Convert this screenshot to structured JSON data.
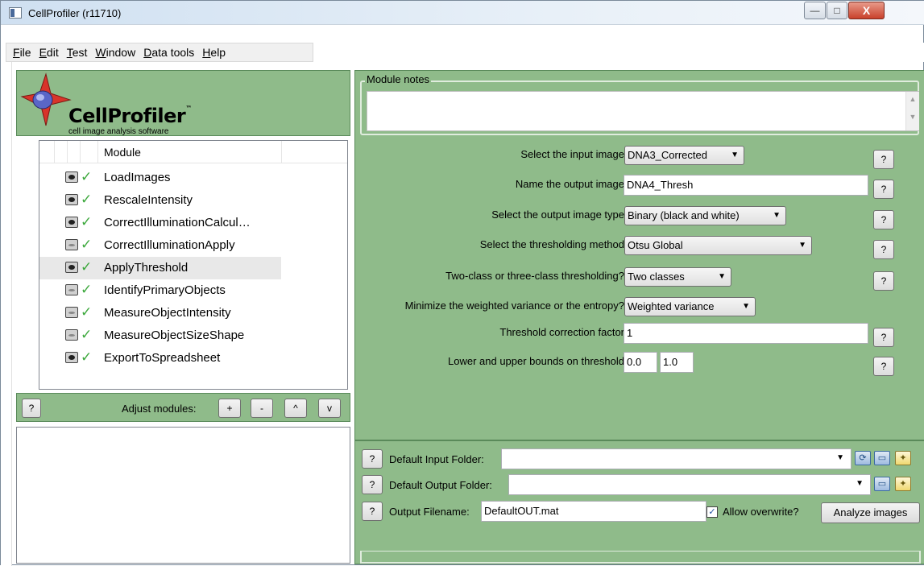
{
  "window": {
    "title": "CellProfiler (r11710)",
    "controls": {
      "minimize": "—",
      "maximize": "□",
      "close": "X"
    }
  },
  "menu": [
    "File",
    "Edit",
    "Test",
    "Window",
    "Data tools",
    "Help"
  ],
  "logo": {
    "name": "CellProfiler",
    "tm": "™",
    "subtitle": "cell image analysis software"
  },
  "module_list": {
    "header": "Module",
    "items": [
      {
        "name": "LoadImages",
        "eye": "open",
        "checked": true
      },
      {
        "name": "RescaleIntensity",
        "eye": "open",
        "checked": true
      },
      {
        "name": "CorrectIlluminationCalcul…",
        "eye": "open",
        "checked": true
      },
      {
        "name": "CorrectIlluminationApply",
        "eye": "closed",
        "checked": true
      },
      {
        "name": "ApplyThreshold",
        "eye": "open",
        "checked": true,
        "selected": true
      },
      {
        "name": "IdentifyPrimaryObjects",
        "eye": "closed",
        "checked": true
      },
      {
        "name": "MeasureObjectIntensity",
        "eye": "closed",
        "checked": true
      },
      {
        "name": "MeasureObjectSizeShape",
        "eye": "closed",
        "checked": true
      },
      {
        "name": "ExportToSpreadsheet",
        "eye": "open",
        "checked": true
      }
    ]
  },
  "adjust": {
    "help": "?",
    "label": "Adjust modules:",
    "add": "+",
    "remove": "-",
    "up": "^",
    "down": "v"
  },
  "notes": {
    "label": "Module notes",
    "value": ""
  },
  "settings": {
    "input_image": {
      "label": "Select the input image",
      "value": "DNA3_Corrected"
    },
    "output_image": {
      "label": "Name the output image",
      "value": "DNA4_Thresh"
    },
    "output_type": {
      "label": "Select the output image type",
      "value": "Binary (black and white)"
    },
    "method": {
      "label": "Select the thresholding method",
      "value": "Otsu Global"
    },
    "classes": {
      "label": "Two-class or three-class thresholding?",
      "value": "Two classes"
    },
    "minimize": {
      "label": "Minimize the weighted variance or the entropy?",
      "value": "Weighted variance"
    },
    "correction": {
      "label": "Threshold correction factor",
      "value": "1"
    },
    "bounds": {
      "label": "Lower and upper bounds on threshold",
      "lower": "0.0",
      "upper": "1.0"
    },
    "help": "?"
  },
  "folders": {
    "help": "?",
    "input_label": "Default Input Folder:",
    "input_value": "",
    "output_label": "Default Output Folder:",
    "output_value": "",
    "filename_label": "Output Filename:",
    "filename_value": "DefaultOUT.mat",
    "overwrite_label": "Allow overwrite?",
    "overwrite_checked": true,
    "analyze": "Analyze images"
  },
  "icons": {
    "dropdown": "▼",
    "check": "✓",
    "refresh": "⟳",
    "folder": "▭",
    "new_folder": "✦"
  }
}
